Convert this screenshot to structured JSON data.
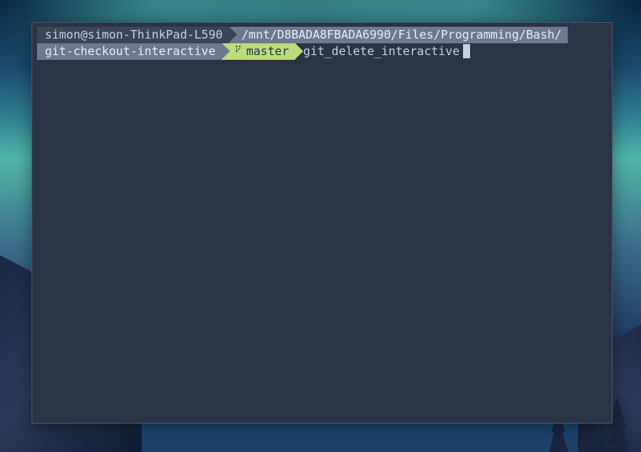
{
  "prompt": {
    "user_host": "simon@simon-ThinkPad-L590",
    "path_line1": "/mnt/D8BADA8FBADA6990/Files/Programming/Bash/",
    "path_line2": "git-checkout-interactive",
    "branch": "master",
    "command": "git_delete_interactive"
  },
  "colors": {
    "terminal_bg": "#2b3444",
    "user_seg_bg": "#3a4556",
    "path_seg_bg": "#6b7a8f",
    "branch_seg_bg": "#b8de7a",
    "text_light": "#c5d0de"
  }
}
